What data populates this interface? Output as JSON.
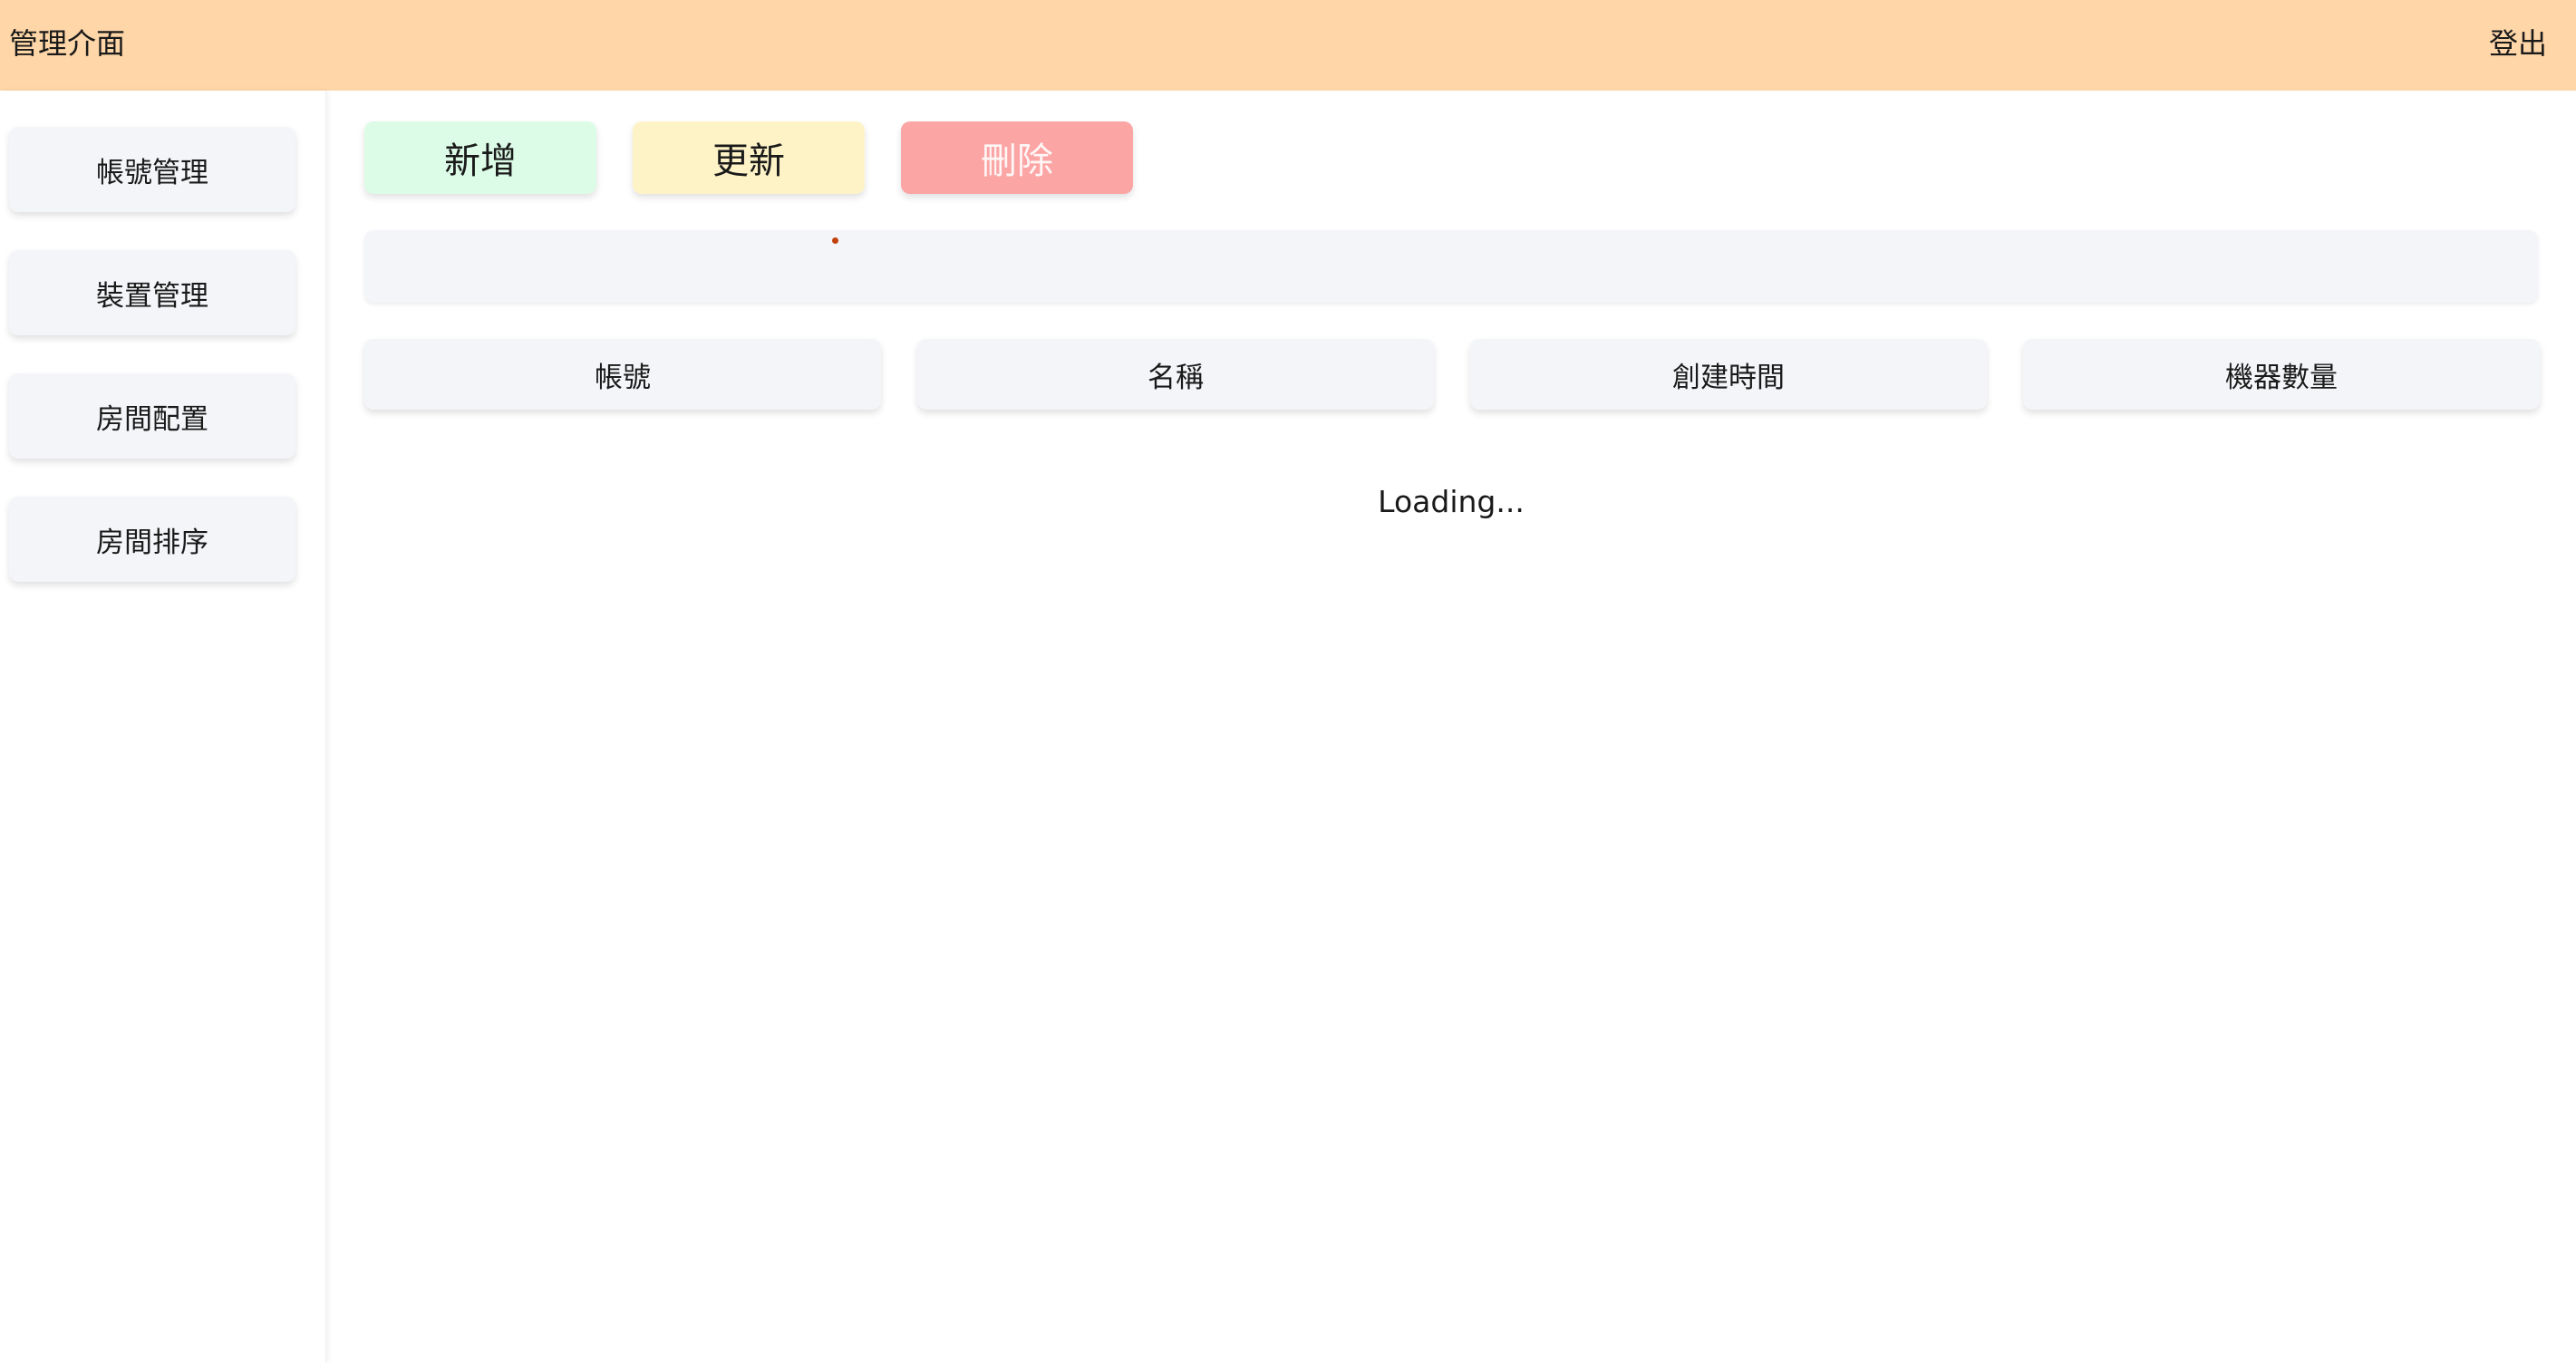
{
  "header": {
    "title": "管理介面",
    "logout_label": "登出"
  },
  "sidebar": {
    "items": [
      {
        "label": "帳號管理"
      },
      {
        "label": "裝置管理"
      },
      {
        "label": "房間配置"
      },
      {
        "label": "房間排序"
      }
    ]
  },
  "toolbar": {
    "add_label": "新增",
    "update_label": "更新",
    "delete_label": "刪除"
  },
  "search": {
    "value": ""
  },
  "table": {
    "columns": [
      "帳號",
      "名稱",
      "創建時間",
      "機器數量"
    ]
  },
  "status": {
    "loading_text": "Loading..."
  },
  "colors": {
    "header_bg": "#fed6a8",
    "add_bg": "#dcfce7",
    "update_bg": "#fef3c7",
    "delete_bg": "#fca5a5",
    "panel_bg": "#f3f5f8"
  }
}
